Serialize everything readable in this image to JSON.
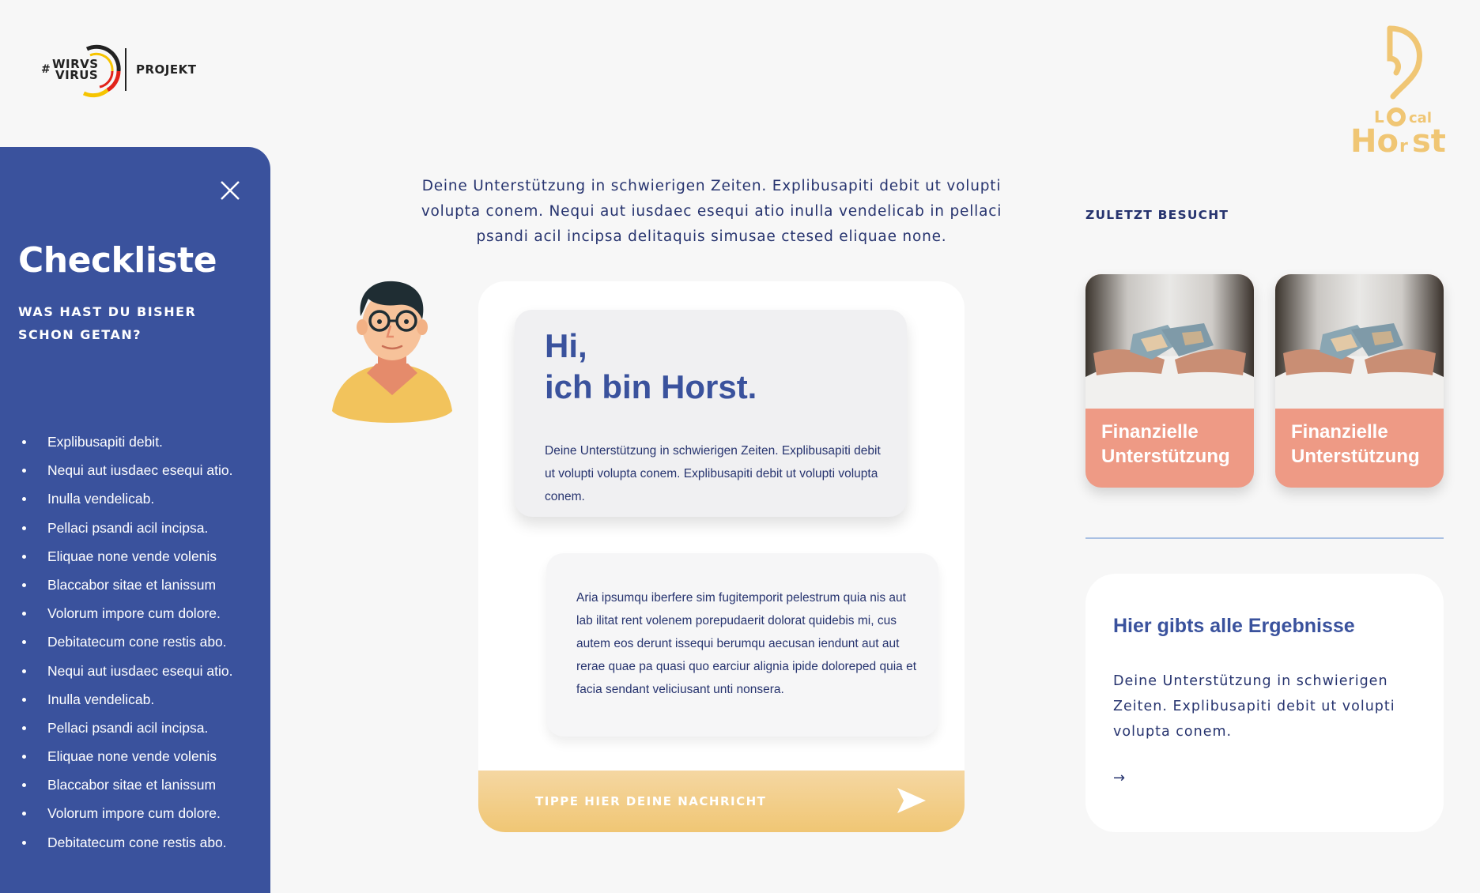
{
  "header": {
    "logo_hash": "#",
    "logo_line1": "WIRVS",
    "logo_line2": "VIRUS",
    "logo_suffix": "PROJEKT",
    "brand_logo_text": "LOcal Horst"
  },
  "sidebar": {
    "title": "Checkliste",
    "subtitle": "WAS HAST DU BISHER SCHON GETAN?",
    "items": [
      "Explibusapiti debit.",
      "Nequi aut iusdaec esequi atio.",
      "Inulla vendelicab.",
      "Pellaci psandi acil incipsa.",
      "Eliquae none vende volenis",
      "Blaccabor sitae et lanissum",
      "Volorum impore cum dolore.",
      "Debitatecum cone restis abo.",
      "Nequi aut iusdaec esequi atio.",
      "Inulla vendelicab.",
      "Pellaci psandi acil incipsa.",
      "Eliquae none vende volenis",
      "Blaccabor sitae et lanissum",
      "Volorum impore cum dolore.",
      "Debitatecum cone restis abo."
    ]
  },
  "intro": {
    "text": "Deine Unterstützung in schwierigen Zeiten. Explibusapiti debit ut volupti volupta conem. Nequi aut iusdaec esequi atio inulla vendelicab in pellaci psandi acil incipsa delitaquis simusae ctesed eliquae none."
  },
  "chat": {
    "greeting_line1": "Hi,",
    "greeting_line2": "ich bin Horst.",
    "message1": "Deine Unterstützung in schwierigen Zeiten. Explibusapiti debit ut volupti volupta conem. Explibusapiti debit ut volupti volupta conem.",
    "message2": "Aria ipsumqu iberfere sim fugitemporit pelestrum quia nis aut lab ilitat rent volenem porepudaerit dolorat quidebis mi, cus autem eos derunt issequi berumqu aecusan iendunt aut aut rerae quae pa quasi quo earciur alignia ipide doloreped quia et facia sendant veliciusant unti nonsera.",
    "input_placeholder": "TIPPE HIER DEINE NACHRICHT"
  },
  "recent": {
    "title": "ZULETZT BESUCHT",
    "cards": [
      {
        "label": "Finanzielle Unterstützung"
      },
      {
        "label": "Finanzielle Unterstützung"
      }
    ]
  },
  "results": {
    "title": "Hier gibts alle Ergebnisse",
    "text": "Deine Unterstützung in schwierigen Zeiten. Explibusapiti debit ut volupti volupta conem.",
    "arrow": "→"
  },
  "colors": {
    "primary_blue": "#3a529d",
    "text_navy": "#27346f",
    "salmon": "#ee9a85",
    "yellow": "#f0c674",
    "background": "#f7f7f7"
  }
}
